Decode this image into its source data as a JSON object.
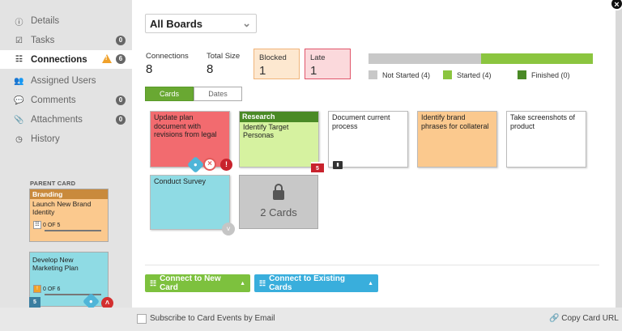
{
  "sidebar": {
    "items": [
      {
        "label": "Details",
        "icon": "info-icon"
      },
      {
        "label": "Tasks",
        "icon": "checkbox-icon",
        "count": "0"
      },
      {
        "label": "Connections",
        "icon": "hierarchy-icon",
        "count": "6",
        "warning": true
      },
      {
        "label": "Assigned Users",
        "icon": "users-icon"
      },
      {
        "label": "Comments",
        "icon": "comment-icon",
        "count": "0"
      },
      {
        "label": "Attachments",
        "icon": "paperclip-icon",
        "count": "0"
      },
      {
        "label": "History",
        "icon": "clock-icon"
      }
    ],
    "parent_label": "PARENT CARD",
    "parent_cards": [
      {
        "lane": "Branding",
        "title": "Launch New Brand Identity",
        "progress": "0 OF 5"
      },
      {
        "title": "Develop New Marketing Plan",
        "progress": "0 OF 6",
        "badge": "5"
      }
    ]
  },
  "main": {
    "board_select": "All Boards",
    "stats": {
      "connections_label": "Connections",
      "connections_value": "8",
      "total_size_label": "Total Size",
      "total_size_value": "8",
      "blocked_label": "Blocked",
      "blocked_value": "1",
      "late_label": "Late",
      "late_value": "1"
    },
    "progress": {
      "not_started": 0.5,
      "started": 0.5,
      "finished": 0
    },
    "legend": [
      {
        "label": "Not Started (4)",
        "color": "#c8c8c8"
      },
      {
        "label": "Started (4)",
        "color": "#8bc53f"
      },
      {
        "label": "Finished (0)",
        "color": "#4a8a26"
      }
    ],
    "tabs": [
      "Cards",
      "Dates"
    ],
    "cards": [
      {
        "text": "Update plan document with revisions from legal",
        "color": "#f26b6f"
      },
      {
        "lane": "Research",
        "text": "Identify Target Personas",
        "color": "#d6f2a0",
        "badge": "5"
      },
      {
        "text": "Document current process",
        "color": "#ffffff"
      },
      {
        "text": "Identify brand phrases for collateral",
        "color": "#fbc98e"
      },
      {
        "text": "Take screenshots of product",
        "color": "#ffffff"
      },
      {
        "text": "Conduct Survey",
        "color": "#8fdbe4"
      }
    ],
    "more_cards_label": "2 Cards",
    "buttons": {
      "connect_new": "Connect to New Card",
      "connect_existing": "Connect to Existing Cards"
    }
  },
  "footer": {
    "subscribe_label": "Subscribe to Card Events by Email",
    "copy_url_label": "Copy Card URL"
  }
}
